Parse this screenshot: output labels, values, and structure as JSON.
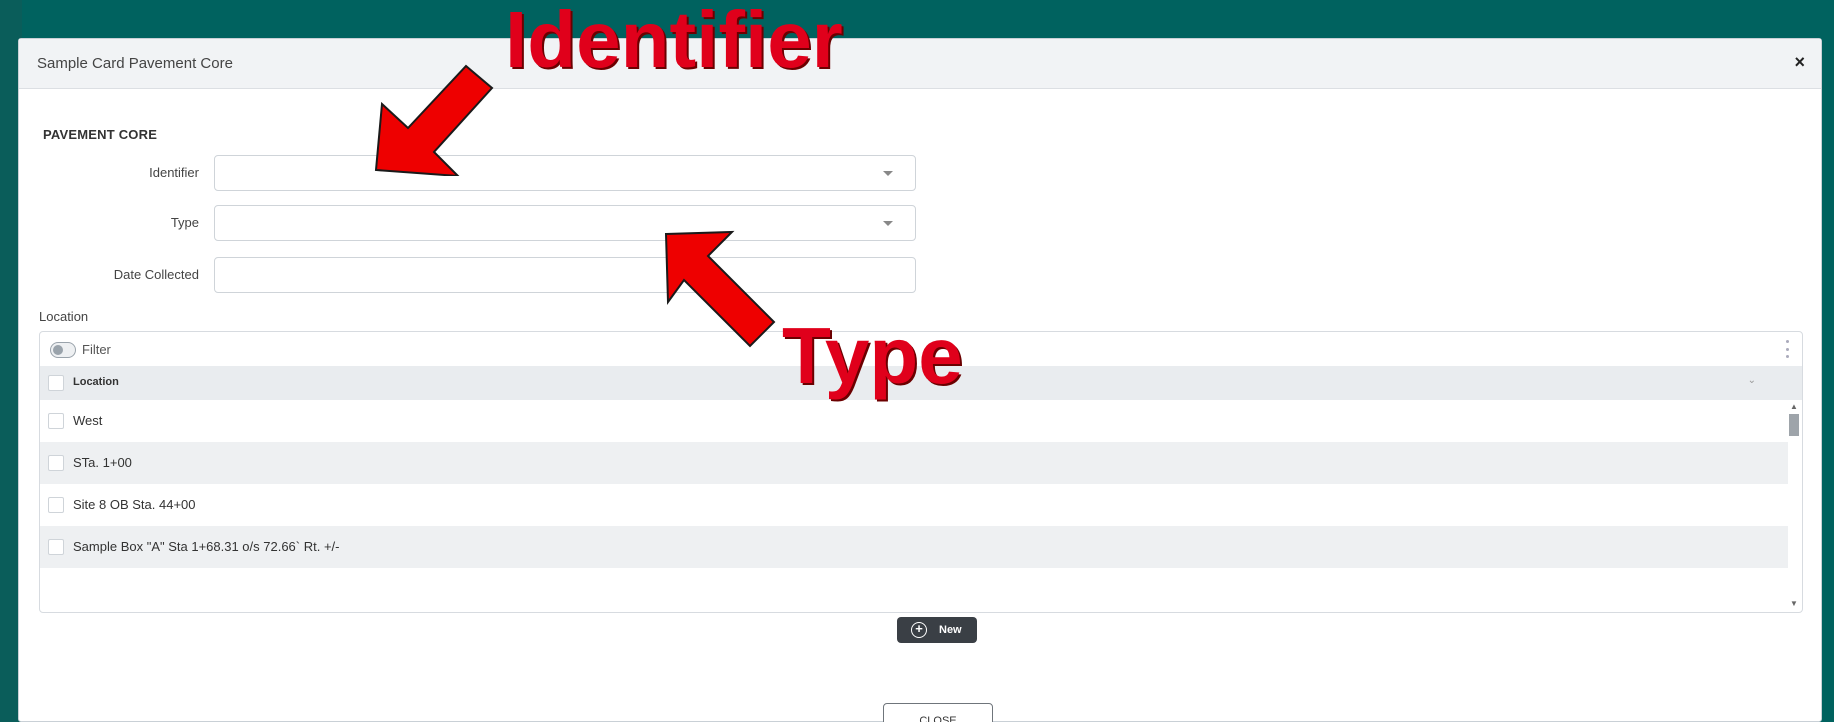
{
  "modal": {
    "title": "Sample Card Pavement Core",
    "close_x": "×",
    "section_heading": "PAVEMENT CORE",
    "fields": {
      "identifier_label": "Identifier",
      "type_label": "Type",
      "date_label": "Date Collected"
    },
    "location": {
      "label": "Location",
      "filter_label": "Filter",
      "column_header": "Location",
      "rows": [
        "West",
        "STa. 1+00",
        "Site 8 OB Sta. 44+00",
        "Sample Box \"A\" Sta 1+68.31 o/s 72.66` Rt. +/-"
      ],
      "new_button": "New"
    },
    "close_button": "CLOSE"
  },
  "annotations": {
    "identifier": "Identifier",
    "type": "Type",
    "color": "#e0001b"
  }
}
